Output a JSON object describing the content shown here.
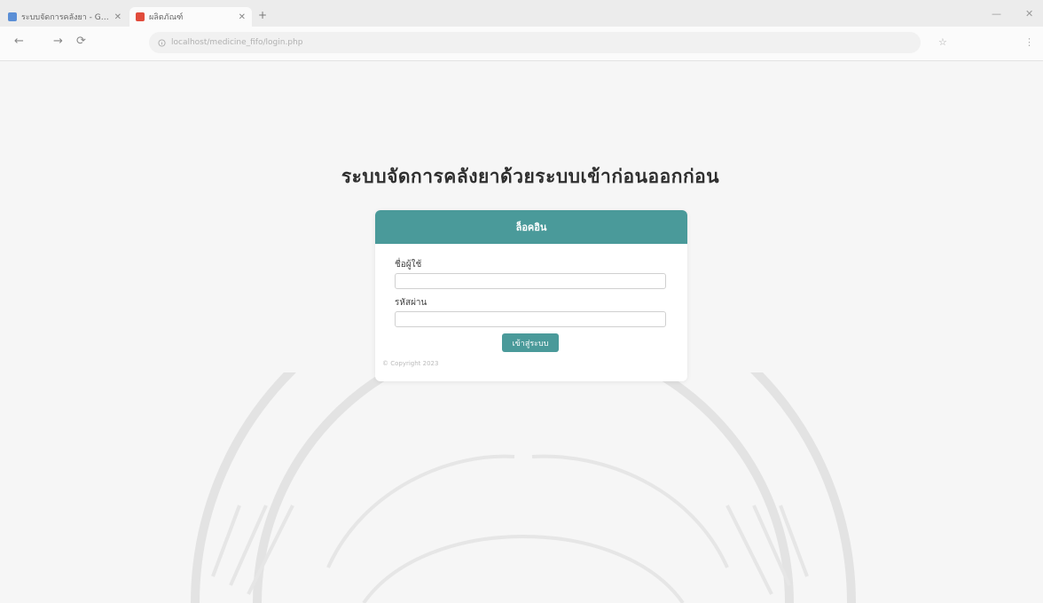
{
  "browser": {
    "tabs": [
      {
        "title": "ระบบจัดการคลังยา - Google",
        "favicon_color": "#5b8fd6"
      },
      {
        "title": "ผลิตภัณฑ์",
        "favicon_color": "#e14b3b"
      }
    ],
    "new_tab_glyph": "+",
    "window_controls": {
      "minimize": "—",
      "close": "✕"
    },
    "nav": {
      "back": "←",
      "forward": "→",
      "reload": "⟳"
    },
    "url": "localhost/medicine_fifo/login.php",
    "toolbar_icons": [
      "star-icon",
      "menu-icon"
    ]
  },
  "page": {
    "title": "ระบบจัดการคลังยาด้วยระบบเข้าก่อนออกก่อน"
  },
  "login": {
    "header": "ล็อคอิน",
    "username_label": "ชื่อผู้ใช้",
    "username_value": "",
    "password_label": "รหัสผ่าน",
    "password_value": "",
    "submit_label": "เข้าสู่ระบบ",
    "footer": "© Copyright 2023"
  },
  "colors": {
    "accent": "#4a9a9a",
    "title": "#2f2f2f",
    "background": "#f6f6f6"
  }
}
